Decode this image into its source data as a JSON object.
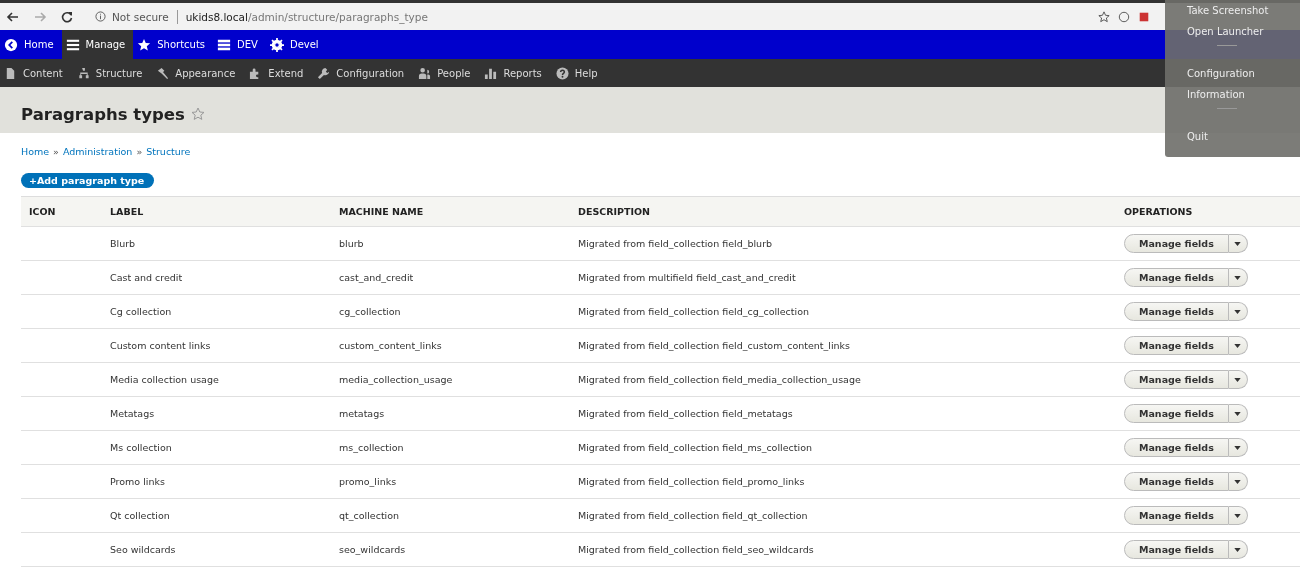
{
  "browser": {
    "security": "Not secure",
    "url_host": "ukids8.local",
    "url_path": "/admin/structure/paragraphs_type"
  },
  "toolbar": [
    {
      "label": "Home",
      "kind": "back",
      "selected": false
    },
    {
      "label": "Manage",
      "kind": "menu",
      "selected": true
    },
    {
      "label": "Shortcuts",
      "kind": "star",
      "selected": false
    },
    {
      "label": "DEV",
      "kind": "server",
      "selected": false
    },
    {
      "label": "Devel",
      "kind": "gear",
      "selected": false
    }
  ],
  "admin_menu": [
    {
      "label": "Content",
      "kind": "file"
    },
    {
      "label": "Structure",
      "kind": "tree"
    },
    {
      "label": "Appearance",
      "kind": "brush"
    },
    {
      "label": "Extend",
      "kind": "puzzle"
    },
    {
      "label": "Configuration",
      "kind": "wrench"
    },
    {
      "label": "People",
      "kind": "people"
    },
    {
      "label": "Reports",
      "kind": "bars"
    },
    {
      "label": "Help",
      "kind": "help"
    }
  ],
  "page": {
    "title": "Paragraphs types",
    "breadcrumb": [
      "Home",
      "Administration",
      "Structure"
    ],
    "breadcrumb_separator": "»",
    "add_button": "+Add paragraph type"
  },
  "table": {
    "columns": [
      "ICON",
      "LABEL",
      "MACHINE NAME",
      "DESCRIPTION",
      "OPERATIONS"
    ],
    "rows": [
      {
        "label": "Blurb",
        "machine_name": "blurb",
        "description": "Migrated from field_collection field_blurb",
        "operation": "Manage fields"
      },
      {
        "label": "Cast and credit",
        "machine_name": "cast_and_credit",
        "description": "Migrated from multifield field_cast_and_credit",
        "operation": "Manage fields"
      },
      {
        "label": "Cg collection",
        "machine_name": "cg_collection",
        "description": "Migrated from field_collection field_cg_collection",
        "operation": "Manage fields"
      },
      {
        "label": "Custom content links",
        "machine_name": "custom_content_links",
        "description": "Migrated from field_collection field_custom_content_links",
        "operation": "Manage fields"
      },
      {
        "label": "Media collection usage",
        "machine_name": "media_collection_usage",
        "description": "Migrated from field_collection field_media_collection_usage",
        "operation": "Manage fields"
      },
      {
        "label": "Metatags",
        "machine_name": "metatags",
        "description": "Migrated from field_collection field_metatags",
        "operation": "Manage fields"
      },
      {
        "label": "Ms collection",
        "machine_name": "ms_collection",
        "description": "Migrated from field_collection field_ms_collection",
        "operation": "Manage fields"
      },
      {
        "label": "Promo links",
        "machine_name": "promo_links",
        "description": "Migrated from field_collection field_promo_links",
        "operation": "Manage fields"
      },
      {
        "label": "Qt collection",
        "machine_name": "qt_collection",
        "description": "Migrated from field_collection field_qt_collection",
        "operation": "Manage fields"
      },
      {
        "label": "Seo wildcards",
        "machine_name": "seo_wildcards",
        "description": "Migrated from field_collection field_seo_wildcards",
        "operation": "Manage fields"
      }
    ]
  },
  "context_menu": [
    {
      "label": "Take Screenshot",
      "kind": "item"
    },
    {
      "label": "Open Launcher",
      "kind": "item"
    },
    {
      "kind": "separator"
    },
    {
      "label": "Configuration",
      "kind": "item"
    },
    {
      "label": "Information",
      "kind": "item"
    },
    {
      "kind": "separator"
    },
    {
      "label": "Quit",
      "kind": "item"
    }
  ]
}
